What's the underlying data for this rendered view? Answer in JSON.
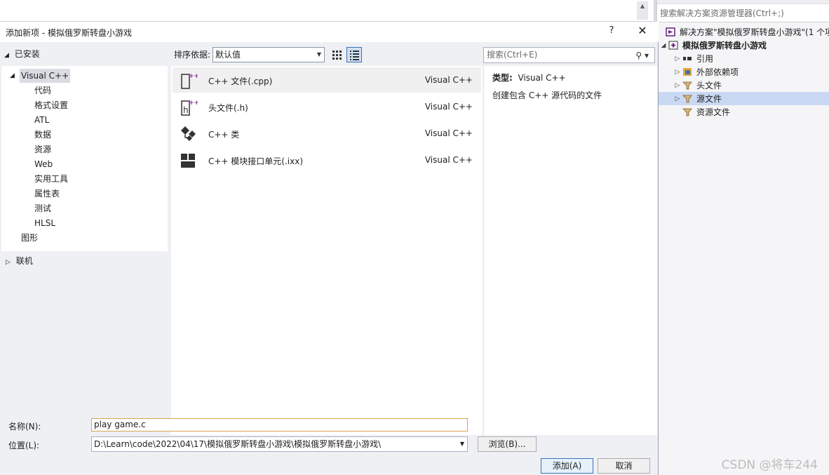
{
  "dialog": {
    "title": "添加新项 - 模拟俄罗斯转盘小游戏",
    "help": "?",
    "close": "✕"
  },
  "left": {
    "installed_label": "已安装",
    "tree": [
      "Visual C++",
      "代码",
      "格式设置",
      "ATL",
      "数据",
      "资源",
      "Web",
      "实用工具",
      "属性表",
      "测试",
      "HLSL",
      "图形"
    ],
    "online_label": "联机"
  },
  "toolbar": {
    "sort_label": "排序依据:",
    "sort_value": "默认值",
    "search_placeholder": "搜索(Ctrl+E)"
  },
  "templates": [
    {
      "name": "C++ 文件(.cpp)",
      "lang": "Visual C++",
      "icon": "cpp-file-icon"
    },
    {
      "name": "头文件(.h)",
      "lang": "Visual C++",
      "icon": "header-file-icon"
    },
    {
      "name": "C++ 类",
      "lang": "Visual C++",
      "icon": "cpp-class-icon"
    },
    {
      "name": "C++ 模块接口单元(.ixx)",
      "lang": "Visual C++",
      "icon": "module-icon"
    }
  ],
  "details": {
    "type_label": "类型:",
    "type_value": "Visual C++",
    "description": "创建包含 C++ 源代码的文件"
  },
  "form": {
    "name_label": "名称(N):",
    "name_value": "play game.c",
    "location_label": "位置(L):",
    "location_value": "D:\\Learn\\code\\2022\\04\\17\\模拟俄罗斯转盘小游戏\\模拟俄罗斯转盘小游戏\\",
    "browse_label": "浏览(B)...",
    "add_label": "添加(A)",
    "cancel_label": "取消"
  },
  "solution_explorer": {
    "search_placeholder": "搜索解决方案资源管理器(Ctrl+;)",
    "solution_label": "解决方案\"模拟俄罗斯转盘小游戏\"(1 个项",
    "project_label": "模拟俄罗斯转盘小游戏",
    "items": [
      "引用",
      "外部依赖项",
      "头文件",
      "源文件",
      "资源文件"
    ]
  },
  "watermark": "CSDN @将车244",
  "colors": {
    "accent": "#3d6fb5",
    "selection": "#c9d9f3",
    "name_focus_border": "#d7a752"
  }
}
